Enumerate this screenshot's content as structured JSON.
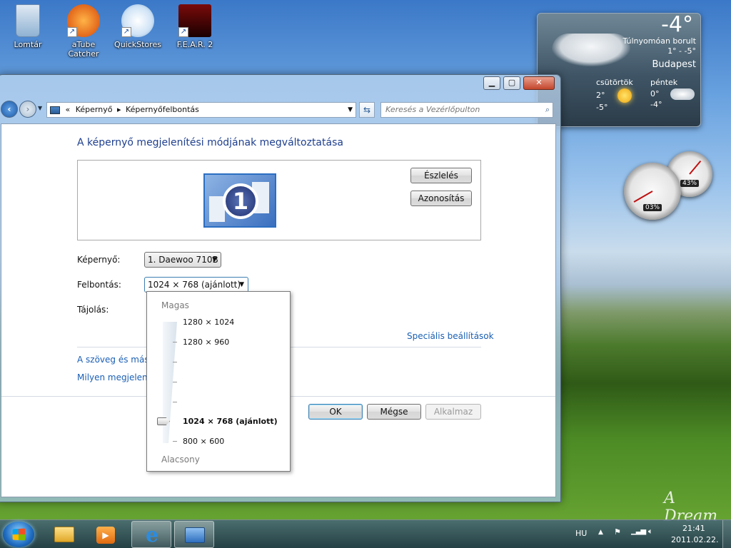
{
  "desktop": {
    "icons": [
      {
        "label": "Lomtár",
        "icon": "recycle-bin-icon"
      },
      {
        "label": "aTube Catcher",
        "icon": "atube-catcher-icon"
      },
      {
        "label": "QuickStores",
        "icon": "quickstores-icon"
      },
      {
        "label": "F.E.A.R. 2",
        "icon": "fear2-icon"
      }
    ],
    "watermark": "A Dream"
  },
  "weather": {
    "temp": "-4°",
    "condition": "Túlnyomóan borult",
    "range": "1° - -5°",
    "city": "Budapest",
    "days": [
      {
        "name": "csütörtök",
        "hi": "2°",
        "lo": "-5°",
        "icon": "sun-icon"
      },
      {
        "name": "péntek",
        "hi": "0°",
        "lo": "-4°",
        "icon": "cloud-icon"
      }
    ]
  },
  "meters": {
    "cpu": "03%",
    "mem": "43%"
  },
  "window": {
    "breadcrumb": {
      "prefix": "«",
      "items": [
        "Képernyő",
        "Képernyőfelbontás"
      ]
    },
    "search_placeholder": "Keresés a Vezérlőpulton",
    "caption": {
      "minimize": "▁",
      "maximize": "▢",
      "close": "✕"
    },
    "title": "A képernyő megjelenítési módjának megváltoztatása",
    "monitor_number": "1",
    "detect": "Észlelés",
    "identify": "Azonosítás",
    "display_label": "Képernyő:",
    "display_value": "1. Daewoo 710B",
    "resolution_label": "Felbontás:",
    "resolution_value": "1024 × 768 (ajánlott)",
    "orientation_label": "Tájolás:",
    "advanced": "Speciális beállítások",
    "link1": "A szöveg és más e",
    "link2": "Milyen megjelenít",
    "ok": "OK",
    "cancel": "Mégse",
    "apply": "Alkalmaz"
  },
  "dropdown": {
    "high": "Magas",
    "low": "Alacsony",
    "options": [
      "1280 × 1024",
      "1280 × 960",
      "1024 × 768 (ajánlott)",
      "800 × 600"
    ],
    "selected": "1024 × 768 (ajánlott)"
  },
  "taskbar": {
    "lang": "HU",
    "time": "21:41",
    "date": "2011.02.22."
  }
}
